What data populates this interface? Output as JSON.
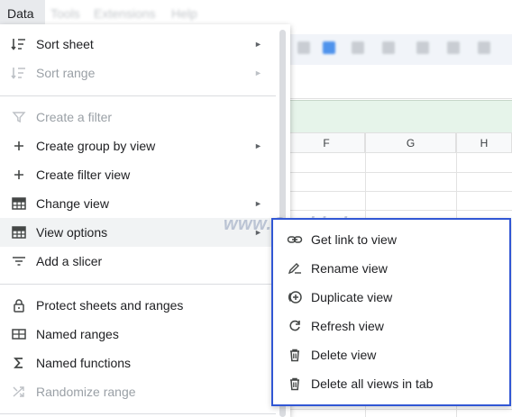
{
  "menubar": {
    "items": [
      "Data",
      "Tools",
      "Extensions",
      "Help"
    ]
  },
  "sheet": {
    "columns": [
      "F",
      "G",
      "H"
    ]
  },
  "data_menu": {
    "items": [
      {
        "label": "Sort sheet",
        "icon": "sort-icon",
        "submenu": true,
        "disabled": false
      },
      {
        "label": "Sort range",
        "icon": "sort-icon",
        "submenu": true,
        "disabled": true
      },
      {
        "label": "Create a filter",
        "icon": "filter-icon",
        "submenu": false,
        "disabled": true
      },
      {
        "label": "Create group by view",
        "icon": "plus-icon",
        "submenu": true,
        "disabled": false
      },
      {
        "label": "Create filter view",
        "icon": "plus-icon",
        "submenu": false,
        "disabled": false
      },
      {
        "label": "Change view",
        "icon": "table-view-icon",
        "submenu": true,
        "disabled": false
      },
      {
        "label": "View options",
        "icon": "table-view-icon",
        "submenu": true,
        "disabled": false,
        "highlighted": true
      },
      {
        "label": "Add a slicer",
        "icon": "slicer-icon",
        "submenu": false,
        "disabled": false
      },
      {
        "label": "Protect sheets and ranges",
        "icon": "lock-icon",
        "submenu": false,
        "disabled": false
      },
      {
        "label": "Named ranges",
        "icon": "named-ranges-icon",
        "submenu": false,
        "disabled": false
      },
      {
        "label": "Named functions",
        "icon": "sigma-icon",
        "submenu": false,
        "disabled": false
      },
      {
        "label": "Randomize range",
        "icon": "shuffle-icon",
        "submenu": false,
        "disabled": true
      }
    ],
    "submenu_arrow": "►"
  },
  "view_options_submenu": {
    "items": [
      {
        "label": "Get link to view",
        "icon": "link-icon"
      },
      {
        "label": "Rename view",
        "icon": "rename-icon"
      },
      {
        "label": "Duplicate view",
        "icon": "duplicate-icon"
      },
      {
        "label": "Refresh view",
        "icon": "refresh-icon"
      },
      {
        "label": "Delete view",
        "icon": "trash-icon"
      },
      {
        "label": "Delete all views in tab",
        "icon": "trash-icon"
      }
    ]
  },
  "watermark": "www.Gguide.ir",
  "colors": {
    "highlight_border": "#3157d4",
    "menu_hover": "#f1f3f4",
    "green_band": "#e6f4ea"
  }
}
